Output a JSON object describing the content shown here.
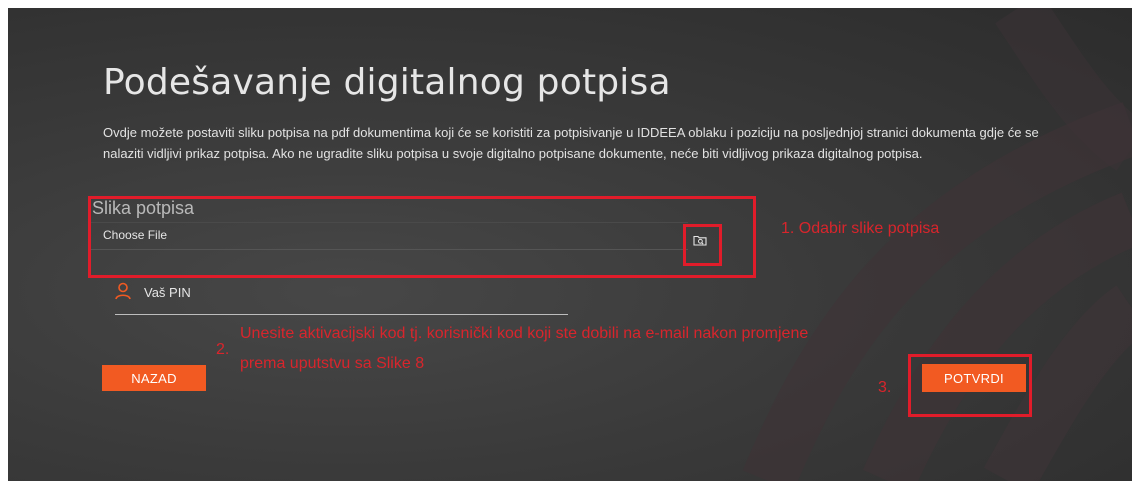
{
  "page": {
    "title": "Podešavanje digitalnog potpisa",
    "description": "Ovdje možete postaviti sliku potpisa na pdf dokumentima koji će se koristiti za potpisivanje u IDDEEA oblaku i poziciju na posljednjoj stranici dokumenta gdje će se nalaziti vidljivi prikaz potpisa. Ako ne ugradite sliku potpisa u svoje digitalno potpisane dokumente, neće biti vidljivog prikaza digitalnog potpisa."
  },
  "signature": {
    "label": "Slika potpisa",
    "file_input": "Choose File",
    "browse_icon": "folder-search-icon"
  },
  "pin": {
    "label": "Vaš PIN",
    "icon": "user-icon"
  },
  "buttons": {
    "back": "NAZAD",
    "confirm": "POTVRDI"
  },
  "annotations": {
    "step1": "1. Odabir slike potpisa",
    "step2_number": "2.",
    "step2_text_line1": "Unesite aktivacijski kod tj. korisnički kod koji ste dobili na e-mail nakon promjene",
    "step2_text_line2": "prema uputstvu sa Slike 8",
    "step3": "3."
  },
  "colors": {
    "accent": "#f25a22",
    "annotation": "#e11c2a",
    "background": "#3a3a3a"
  }
}
